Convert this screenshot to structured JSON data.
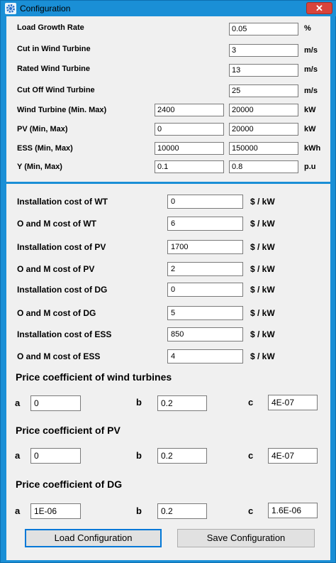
{
  "window": {
    "title": "Configuration",
    "close_label": "✕"
  },
  "general": [
    {
      "label": "Load Growth Rate",
      "values": [
        "0.05"
      ],
      "unit": "%"
    },
    {
      "label": "Cut in Wind Turbine",
      "values": [
        "3"
      ],
      "unit": "m/s"
    },
    {
      "label": "Rated Wind Turbine",
      "values": [
        "13"
      ],
      "unit": "m/s"
    },
    {
      "label": "Cut Off Wind Turbine",
      "values": [
        "25"
      ],
      "unit": "m/s"
    },
    {
      "label": "Wind Turbine (Min. Max)",
      "values": [
        "2400",
        "20000"
      ],
      "unit": "kW"
    },
    {
      "label": "PV (Min, Max)",
      "values": [
        "0",
        "20000"
      ],
      "unit": "kW"
    },
    {
      "label": "ESS (Min, Max)",
      "values": [
        "10000",
        "150000"
      ],
      "unit": "kWh"
    },
    {
      "label": "Y (Min, Max)",
      "values": [
        "0.1",
        "0.8"
      ],
      "unit": "p.u"
    }
  ],
  "costs": [
    {
      "label": "Installation cost of WT",
      "value": "0",
      "unit": "$ / kW"
    },
    {
      "label": "O and M cost of WT",
      "value": "6",
      "unit": "$ / kW"
    },
    {
      "label": "Installation cost of PV",
      "value": "1700",
      "unit": "$ / kW"
    },
    {
      "label": "O and M cost of PV",
      "value": "2",
      "unit": "$ / kW"
    },
    {
      "label": "Installation cost of DG",
      "value": "0",
      "unit": "$ / kW"
    },
    {
      "label": "O and M cost of DG",
      "value": "5",
      "unit": "$ / kW"
    },
    {
      "label": "Installation cost of ESS",
      "value": "850",
      "unit": "$ / kW"
    },
    {
      "label": "O and M cost of ESS",
      "value": "4",
      "unit": "$ / kW"
    }
  ],
  "coefficients": [
    {
      "title": "Price coefficient of wind turbines",
      "a": "0",
      "b": "0.2",
      "c": "4E-07"
    },
    {
      "title": "Price coefficient of PV",
      "a": "0",
      "b": "0.2",
      "c": "4E-07"
    },
    {
      "title": "Price coefficient of DG",
      "a": "1E-06",
      "b": "0.2",
      "c": "1.6E-06"
    }
  ],
  "coef_labels": {
    "a": "a",
    "b": "b",
    "c": "c"
  },
  "buttons": {
    "load": "Load Configuration",
    "save": "Save Configuration"
  },
  "colors": {
    "titlebar": "#1a8fd6",
    "close": "#d9443b",
    "panel": "#f0f0f0"
  }
}
